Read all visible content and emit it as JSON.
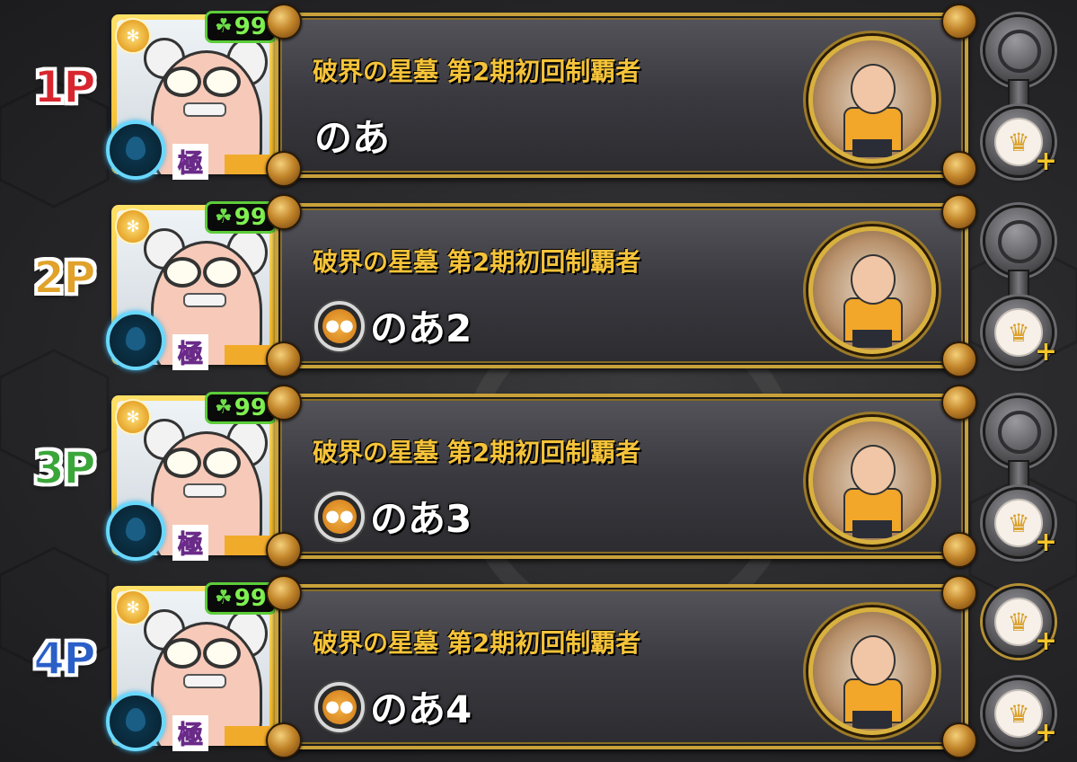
{
  "players": [
    {
      "label": "1P",
      "label_color": "#d8262e",
      "luck": "99",
      "rarity": "極",
      "title": "破界の星墓 第2期初回制覇者",
      "name": "のあ",
      "friend_icon": false,
      "top_button": "empty-slot",
      "bottom_button": "crown-add"
    },
    {
      "label": "2P",
      "label_color": "#e0a22a",
      "luck": "99",
      "rarity": "極",
      "title": "破界の星墓 第2期初回制覇者",
      "name": "のあ2",
      "friend_icon": true,
      "top_button": "empty-slot",
      "bottom_button": "crown-add"
    },
    {
      "label": "3P",
      "label_color": "#3aa63a",
      "luck": "99",
      "rarity": "極",
      "title": "破界の星墓 第2期初回制覇者",
      "name": "のあ3",
      "friend_icon": true,
      "top_button": "empty-slot",
      "bottom_button": "crown-add"
    },
    {
      "label": "4P",
      "label_color": "#2a5fc8",
      "luck": "99",
      "rarity": "極",
      "title": "破界の星墓 第2期初回制覇者",
      "name": "のあ4",
      "friend_icon": true,
      "top_button": "crown-add",
      "bottom_button": "crown-add"
    }
  ],
  "icons": {
    "clover": "☘",
    "medal": "✻",
    "crown": "♛",
    "plus": "+"
  },
  "colors": {
    "title_gold": "#f5c33a",
    "panel_border": "#c9a13a",
    "luck_green": "#5ccc39",
    "element_blue": "#69d8ff"
  }
}
